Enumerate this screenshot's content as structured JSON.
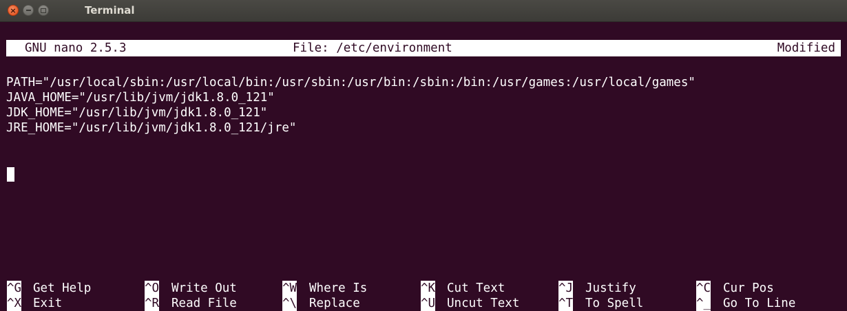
{
  "window": {
    "title": "Terminal"
  },
  "nano": {
    "version": "GNU nano 2.5.3",
    "file": "File: /etc/environment",
    "status": "Modified"
  },
  "lines": [
    "PATH=\"/usr/local/sbin:/usr/local/bin:/usr/sbin:/usr/bin:/sbin:/bin:/usr/games:/usr/local/games\"",
    "JAVA_HOME=\"/usr/lib/jvm/jdk1.8.0_121\"",
    "JDK_HOME=\"/usr/lib/jvm/jdk1.8.0_121\"",
    "JRE_HOME=\"/usr/lib/jvm/jdk1.8.0_121/jre\""
  ],
  "shortcuts": [
    {
      "key": "^G",
      "label": "Get Help"
    },
    {
      "key": "^O",
      "label": "Write Out"
    },
    {
      "key": "^W",
      "label": "Where Is"
    },
    {
      "key": "^K",
      "label": "Cut Text"
    },
    {
      "key": "^J",
      "label": "Justify"
    },
    {
      "key": "^C",
      "label": "Cur Pos"
    },
    {
      "key": "^X",
      "label": "Exit"
    },
    {
      "key": "^R",
      "label": "Read File"
    },
    {
      "key": "^\\",
      "label": "Replace"
    },
    {
      "key": "^U",
      "label": "Uncut Text"
    },
    {
      "key": "^T",
      "label": "To Spell"
    },
    {
      "key": "^_",
      "label": "Go To Line"
    }
  ],
  "colors": {
    "background": "#300a24",
    "foreground": "#ffffff",
    "titlebar": "#3c3b37",
    "close_button": "#df4b16"
  }
}
